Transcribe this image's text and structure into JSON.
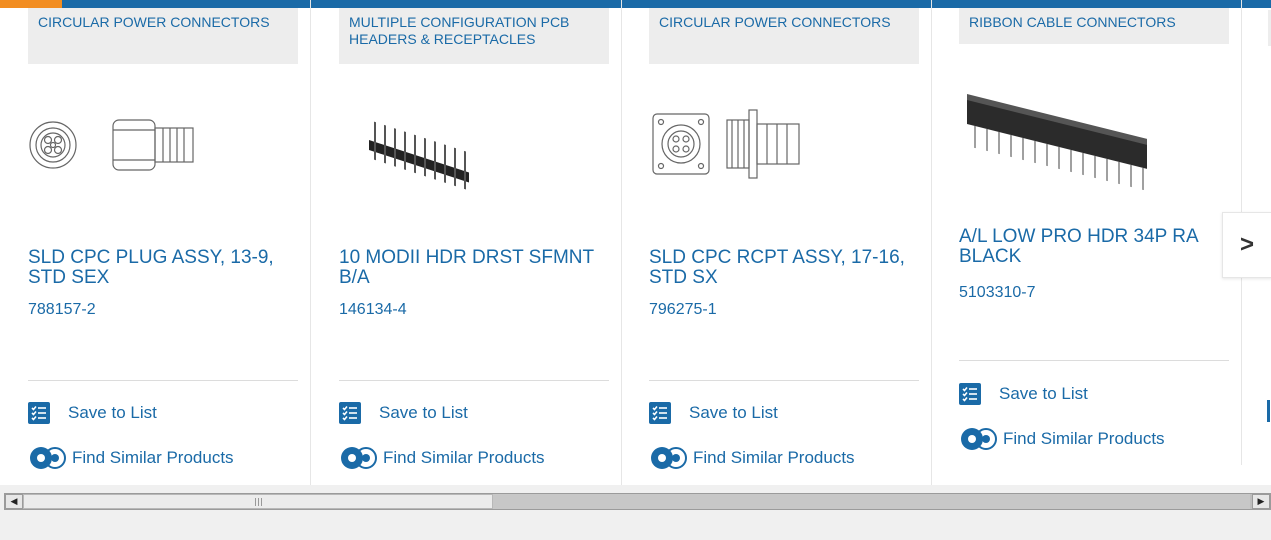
{
  "colors": {
    "brand": "#1a6aa7",
    "accent": "#f28d21",
    "category_bg": "#ededed"
  },
  "cards": [
    {
      "category": "CIRCULAR POWER CONNECTORS",
      "title": "SLD CPC PLUG ASSY, 13-9, STD SEX",
      "part_number": "788157-2",
      "save_label": "Save to List",
      "similar_label": "Find Similar Products",
      "image_icon": "circular-plug-image"
    },
    {
      "category": "MULTIPLE CONFIGURATION PCB HEADERS & RECEPTACLES",
      "title": "10 MODII HDR DRST SFMNT B/A",
      "part_number": "146134-4",
      "save_label": "Save to List",
      "similar_label": "Find Similar Products",
      "image_icon": "pin-header-image"
    },
    {
      "category": "CIRCULAR POWER CONNECTORS",
      "title": "SLD CPC RCPT ASSY, 17-16, STD SX",
      "part_number": "796275-1",
      "save_label": "Save to List",
      "similar_label": "Find Similar Products",
      "image_icon": "circular-receptacle-image"
    },
    {
      "category": "RIBBON CABLE CONNECTORS",
      "title": "A/L LOW PRO HDR 34P RA BLACK",
      "part_number": "5103310-7",
      "save_label": "Save to List",
      "similar_label": "Find Similar Products",
      "image_icon": "ribbon-header-image"
    }
  ],
  "carousel": {
    "next_icon": "chevron-right-icon",
    "next_label": ">"
  },
  "scrollbar": {
    "left_arrow": "◀",
    "right_arrow": "▶"
  }
}
